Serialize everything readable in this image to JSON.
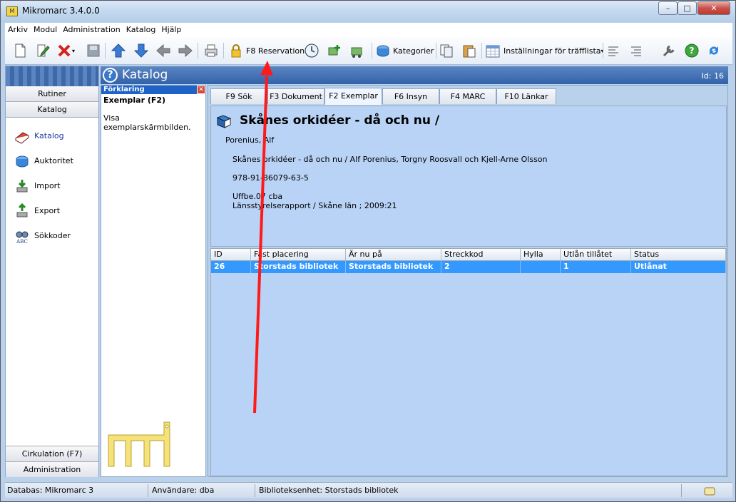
{
  "window": {
    "title": "Mikromarc 3.4.0.0",
    "icon_text": "M",
    "min": "–",
    "max": "□",
    "close": "✕"
  },
  "menu": [
    "Arkiv",
    "Modul",
    "Administration",
    "Katalog",
    "Hjälp"
  ],
  "toolbar": {
    "reservation_label": "F8 Reservation",
    "kategorier_label": "Kategorier",
    "installningar_label": "Inställningar för träfflista",
    "dropdown_caret": "▾"
  },
  "nav": {
    "tabs": [
      "Rutiner",
      "Katalog"
    ],
    "items": [
      "Katalog",
      "Auktoritet",
      "Import",
      "Export",
      "Sökkoder"
    ],
    "bottom": [
      "Cirkulation (F7)",
      "Administration"
    ]
  },
  "header": {
    "title": "Katalog",
    "id": "Id: 16",
    "help": "?"
  },
  "explain": {
    "head": "Förklaring",
    "title": "Exemplar (F2)",
    "desc": "Visa exemplarskärmbilden.",
    "close": "✕"
  },
  "tabs": [
    "F9 Sök",
    "F3 Dokument",
    "F2 Exemplar",
    "F6 Insyn",
    "F4 MARC",
    "F10 Länkar"
  ],
  "record": {
    "title": "Skånes orkidéer - då och nu /",
    "author": "Porenius, Alf",
    "statement": "Skånes orkidéer - då och nu / Alf Porenius, Torgny Roosvall och Kjell-Arne Olsson",
    "isbn": "978-91-86079-63-5",
    "shelf": "Uffbe.07 cba",
    "series": "Länsstyrelserapport / Skåne län ; 2009:21"
  },
  "grid": {
    "columns": [
      "ID",
      "Fast placering",
      "Är nu på",
      "Streckkod",
      "Hylla",
      "Utlån tillåtet",
      "Status"
    ],
    "rows": [
      [
        "26",
        "Storstads bibliotek",
        "Storstads bibliotek",
        "2",
        "",
        "1",
        "Utlånat"
      ]
    ]
  },
  "status": {
    "db": "Databas: Mikromarc 3",
    "user": "Användare: dba",
    "unit": "Biblioteksenhet: Storstads bibliotek"
  },
  "colors": {
    "accent": "#3399ff",
    "header": "#3262a8",
    "arrow": "#ff0000"
  }
}
